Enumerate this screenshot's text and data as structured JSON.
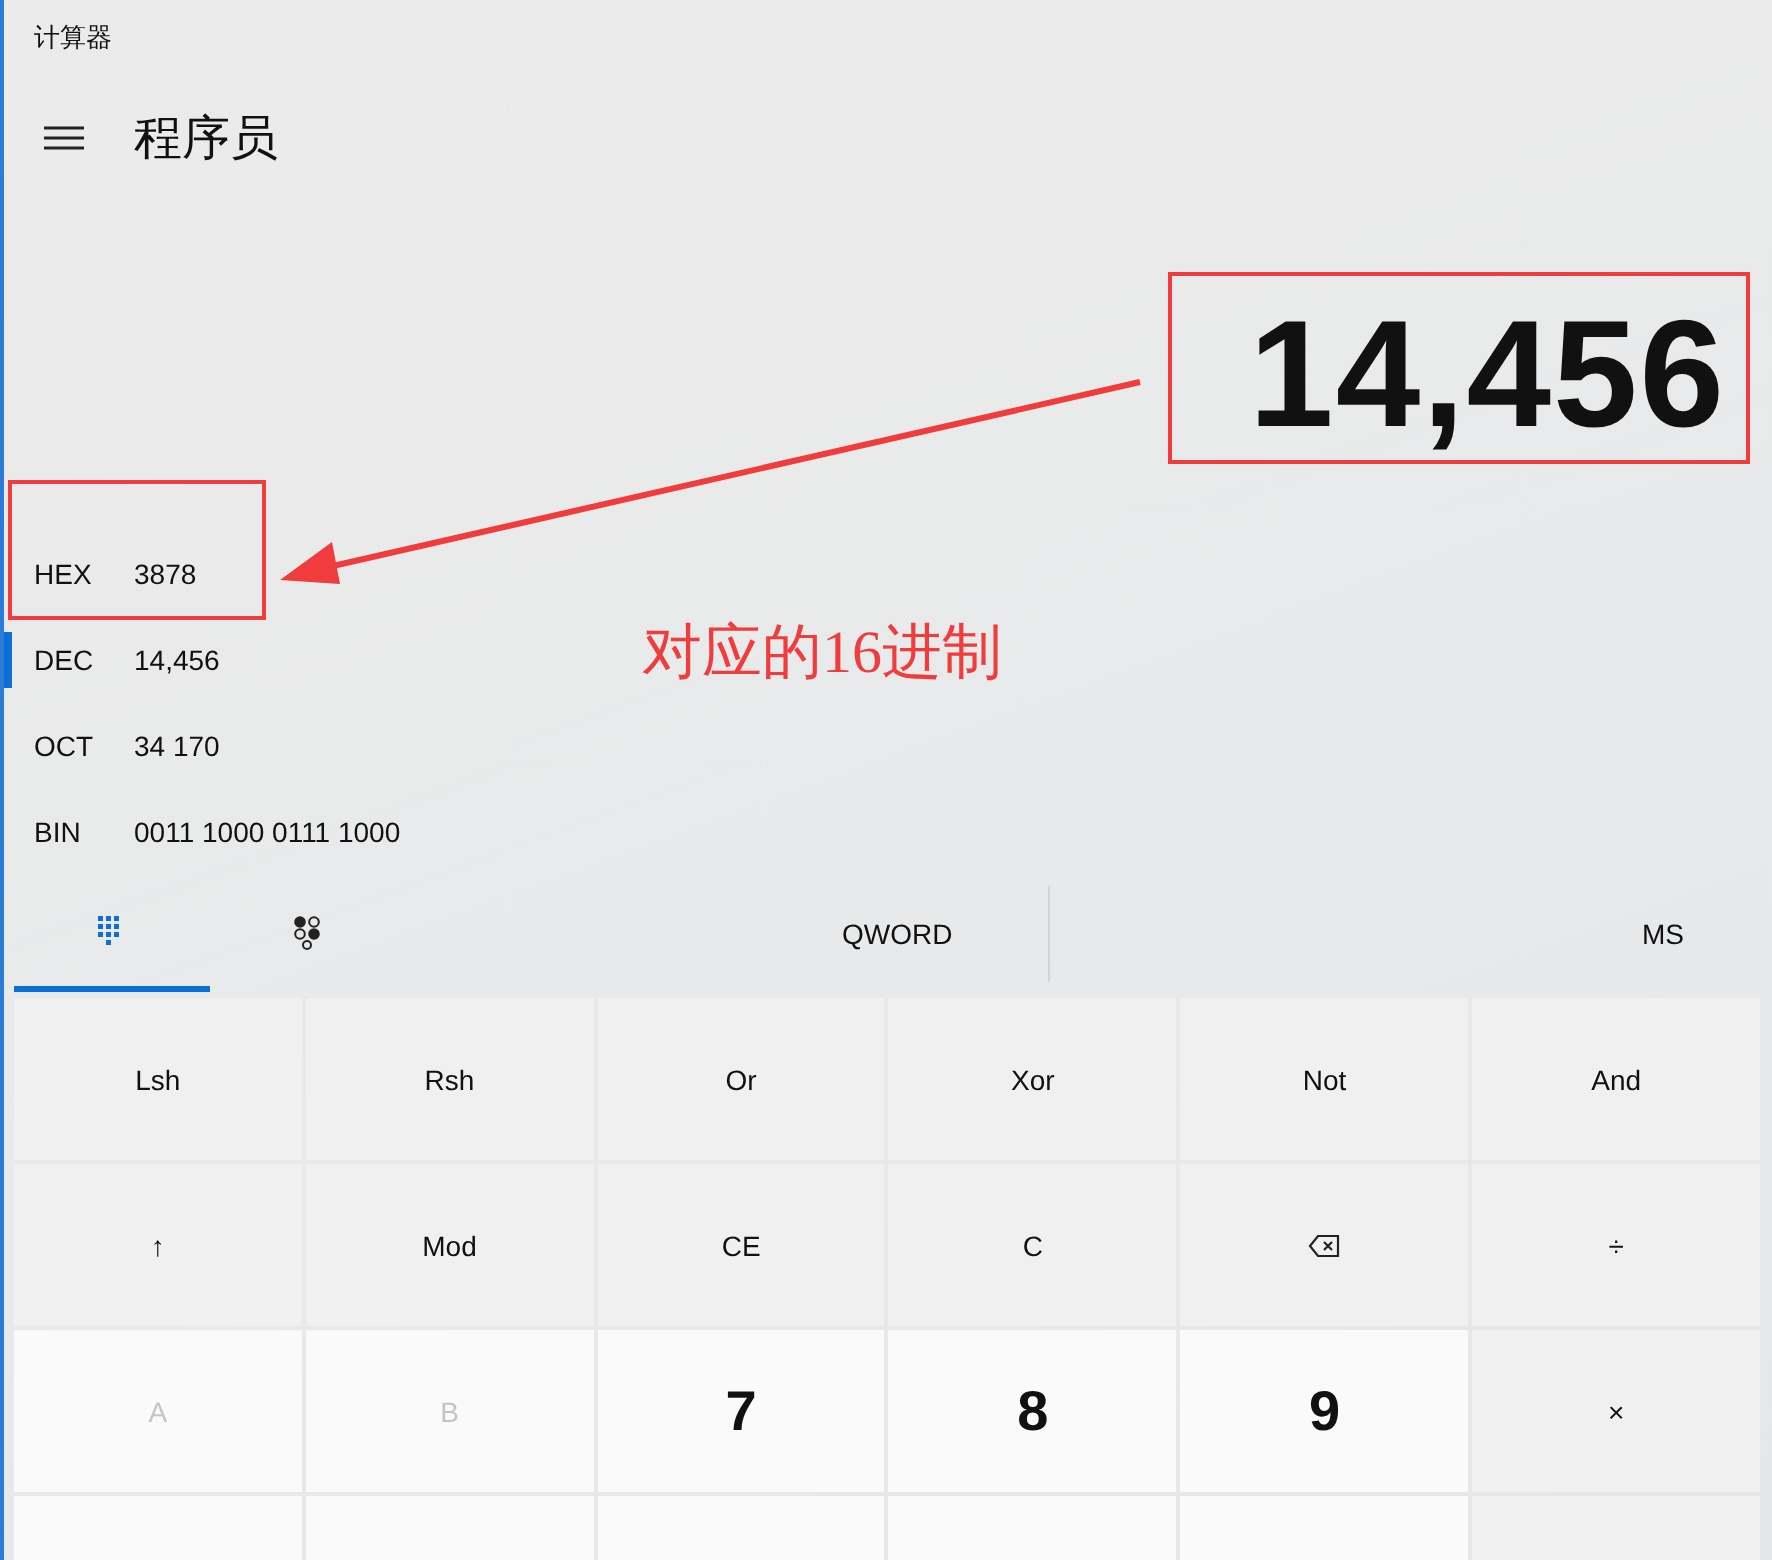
{
  "window": {
    "title": "计算器"
  },
  "header": {
    "title": "程序员"
  },
  "display": {
    "value": "14,456"
  },
  "radix": [
    {
      "name": "HEX",
      "value": "3878",
      "selected": false
    },
    {
      "name": "DEC",
      "value": "14,456",
      "selected": true
    },
    {
      "name": "OCT",
      "value": "34 170",
      "selected": false
    },
    {
      "name": "BIN",
      "value": "0011 1000 0111 1000",
      "selected": false
    }
  ],
  "tabs": [
    {
      "kind": "keypad",
      "selected": true
    },
    {
      "kind": "bits",
      "selected": false
    }
  ],
  "word_size": "QWORD",
  "memory": "MS",
  "keys": [
    [
      {
        "kind": "op",
        "label": "Lsh"
      },
      {
        "kind": "op",
        "label": "Rsh"
      },
      {
        "kind": "op",
        "label": "Or"
      },
      {
        "kind": "op",
        "label": "Xor"
      },
      {
        "kind": "op",
        "label": "Not"
      },
      {
        "kind": "op",
        "label": "And"
      }
    ],
    [
      {
        "kind": "op",
        "label": "↑"
      },
      {
        "kind": "op",
        "label": "Mod"
      },
      {
        "kind": "op",
        "label": "CE"
      },
      {
        "kind": "op",
        "label": "C"
      },
      {
        "kind": "backspace"
      },
      {
        "kind": "op",
        "label": "÷"
      }
    ],
    [
      {
        "kind": "digit",
        "label": "A",
        "disabled": true
      },
      {
        "kind": "digit",
        "label": "B",
        "disabled": true
      },
      {
        "kind": "digit",
        "label": "7",
        "disabled": false
      },
      {
        "kind": "digit",
        "label": "8",
        "disabled": false
      },
      {
        "kind": "digit",
        "label": "9",
        "disabled": false
      },
      {
        "kind": "op",
        "label": "×"
      }
    ],
    [
      {
        "kind": "digit"
      },
      {
        "kind": "digit"
      },
      {
        "kind": "digit"
      },
      {
        "kind": "digit"
      },
      {
        "kind": "digit"
      },
      {
        "kind": "op"
      }
    ]
  ],
  "annotation": {
    "text": "对应的16进制"
  }
}
